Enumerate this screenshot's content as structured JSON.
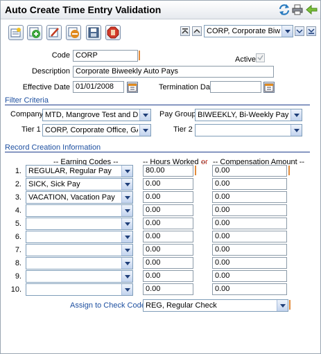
{
  "title": "Auto Create Time Entry Validation",
  "toolbar_icons": [
    "new-record-icon",
    "add-icon",
    "edit-icon",
    "delete-icon",
    "save-icon",
    "stop-icon"
  ],
  "title_icons": [
    "refresh-icon",
    "print-icon",
    "back-arrow-icon"
  ],
  "record_nav": {
    "selected": "CORP, Corporate Biwe"
  },
  "fields": {
    "code_label": "Code",
    "code_value": "CORP",
    "active_label": "Active",
    "description_label": "Description",
    "description_value": "Corporate Biweekly Auto Pays",
    "effective_label": "Effective Date",
    "effective_value": "01/01/2008",
    "termination_label": "Termination Date",
    "termination_value": ""
  },
  "filter": {
    "section_label": "Filter Criteria",
    "company_label": "Company",
    "company_value": "MTD, Mangrove Test and D",
    "paygroup_label": "Pay Group",
    "paygroup_value": "BIWEEKLY, Bi-Weekly Pay",
    "tier1_label": "Tier 1",
    "tier1_value": "CORP, Corporate Office, GA",
    "tier2_label": "Tier 2",
    "tier2_value": ""
  },
  "records": {
    "section_label": "Record Creation Information",
    "col_earning": "-- Earning Codes --",
    "col_hours": "-- Hours Worked --",
    "or_label": "or",
    "col_comp": "-- Compensation Amount --",
    "rows": [
      {
        "num": "1.",
        "code": "REGULAR, Regular Pay",
        "hours": "80.00",
        "comp": "0.00"
      },
      {
        "num": "2.",
        "code": "SICK, Sick Pay",
        "hours": "0.00",
        "comp": "0.00"
      },
      {
        "num": "3.",
        "code": "VACATION, Vacation Pay",
        "hours": "0.00",
        "comp": "0.00"
      },
      {
        "num": "4.",
        "code": "",
        "hours": "0.00",
        "comp": "0.00"
      },
      {
        "num": "5.",
        "code": "",
        "hours": "0.00",
        "comp": "0.00"
      },
      {
        "num": "6.",
        "code": "",
        "hours": "0.00",
        "comp": "0.00"
      },
      {
        "num": "7.",
        "code": "",
        "hours": "0.00",
        "comp": "0.00"
      },
      {
        "num": "8.",
        "code": "",
        "hours": "0.00",
        "comp": "0.00"
      },
      {
        "num": "9.",
        "code": "",
        "hours": "0.00",
        "comp": "0.00"
      },
      {
        "num": "10.",
        "code": "",
        "hours": "0.00",
        "comp": "0.00"
      }
    ],
    "assign_label": "Assign to Check Code",
    "assign_value": "REG, Regular Check"
  }
}
